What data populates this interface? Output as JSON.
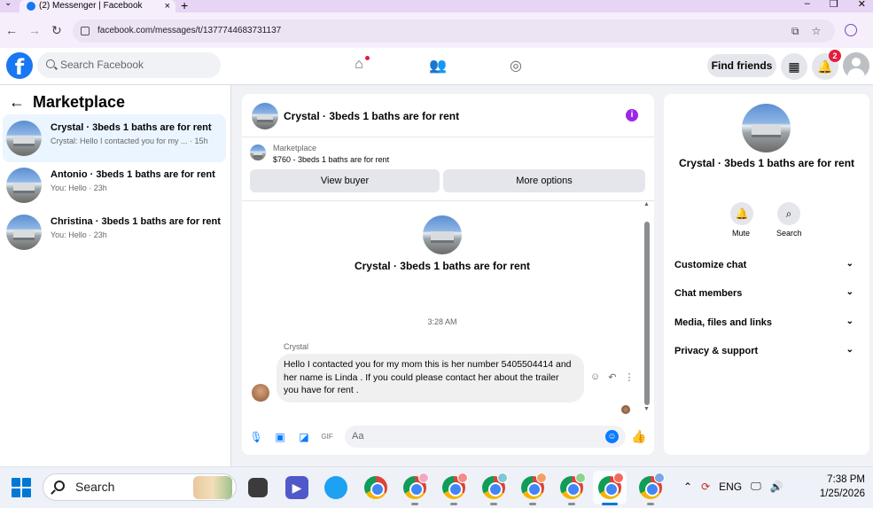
{
  "browser": {
    "tab_title": "(2) Messenger | Facebook",
    "tab_close": "×",
    "new_tab": "+",
    "url": "facebook.com/messages/t/1377744683731137",
    "window_controls": [
      "–",
      "❐",
      "✕"
    ]
  },
  "fb_header": {
    "logo": "f",
    "search_placeholder": "Search Facebook",
    "find_friends": "Find friends",
    "notification_count": "2"
  },
  "left_panel": {
    "back_arrow": "←",
    "title": "Marketplace",
    "conversations": [
      {
        "title": "Crystal · 3beds 1 baths are for rent",
        "subtitle": "Crystal: Hello I contacted you for my ... · 15h",
        "active": true
      },
      {
        "title": "Antonio · 3beds 1 baths are for rent",
        "subtitle": "You: Hello · 23h",
        "active": false
      },
      {
        "title": "Christina · 3beds 1 baths are for rent",
        "subtitle": "You: Hello · 23h",
        "active": false
      }
    ]
  },
  "chat": {
    "header_title": "Crystal · 3beds 1 baths are for rent",
    "info_icon": "i",
    "marketplace_label": "Marketplace",
    "listing": "$760 - 3beds 1 baths are for rent",
    "view_buyer": "View buyer",
    "more_options": "More options",
    "intro_title": "Crystal · 3beds 1 baths are for rent",
    "timestamp": "3:28 AM",
    "sender": "Crystal",
    "message": "Hello I contacted you for my mom this is her number 5405504414 and her name is Linda . If you could please contact her about the trailer you have for rent .",
    "input_placeholder": "Aa",
    "gif_label": "GIF"
  },
  "right_panel": {
    "title": "Crystal · 3beds 1 baths are for rent",
    "mute": "Mute",
    "search": "Search",
    "rows": [
      "Customize chat",
      "Chat members",
      "Media, files and links",
      "Privacy & support"
    ]
  },
  "taskbar": {
    "search_label": "Search",
    "language": "ENG",
    "time": "7:38 PM",
    "date": "1/25/2026"
  },
  "colors": {
    "fb_blue": "#1877f2",
    "messenger_blue": "#0a7cff",
    "active_conv": "#ebf5ff",
    "notification_red": "#e41e3f"
  }
}
